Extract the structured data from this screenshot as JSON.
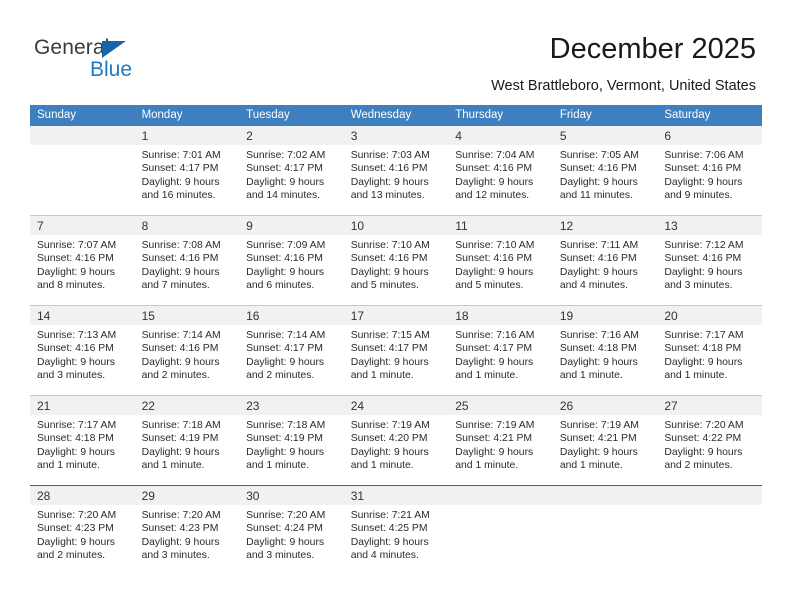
{
  "brand": {
    "name_part1": "General",
    "name_part2": "Blue",
    "triangle_icon": "triangle-icon",
    "primary_color": "#1e7ac0",
    "triangle_color": "#1565a8"
  },
  "header": {
    "title": "December 2025",
    "location": "West Brattleboro, Vermont, United States"
  },
  "calendar": {
    "header_bg": "#3d7fbf",
    "daynum_bg": "#f1f1f1",
    "grid_line": "#c8c8c8",
    "weekday_headers": [
      "Sunday",
      "Monday",
      "Tuesday",
      "Wednesday",
      "Thursday",
      "Friday",
      "Saturday"
    ],
    "weeks": [
      [
        {
          "day": "",
          "lines": []
        },
        {
          "day": "1",
          "lines": [
            "Sunrise: 7:01 AM",
            "Sunset: 4:17 PM",
            "Daylight: 9 hours",
            "and 16 minutes."
          ]
        },
        {
          "day": "2",
          "lines": [
            "Sunrise: 7:02 AM",
            "Sunset: 4:17 PM",
            "Daylight: 9 hours",
            "and 14 minutes."
          ]
        },
        {
          "day": "3",
          "lines": [
            "Sunrise: 7:03 AM",
            "Sunset: 4:16 PM",
            "Daylight: 9 hours",
            "and 13 minutes."
          ]
        },
        {
          "day": "4",
          "lines": [
            "Sunrise: 7:04 AM",
            "Sunset: 4:16 PM",
            "Daylight: 9 hours",
            "and 12 minutes."
          ]
        },
        {
          "day": "5",
          "lines": [
            "Sunrise: 7:05 AM",
            "Sunset: 4:16 PM",
            "Daylight: 9 hours",
            "and 11 minutes."
          ]
        },
        {
          "day": "6",
          "lines": [
            "Sunrise: 7:06 AM",
            "Sunset: 4:16 PM",
            "Daylight: 9 hours",
            "and 9 minutes."
          ]
        }
      ],
      [
        {
          "day": "7",
          "lines": [
            "Sunrise: 7:07 AM",
            "Sunset: 4:16 PM",
            "Daylight: 9 hours",
            "and 8 minutes."
          ]
        },
        {
          "day": "8",
          "lines": [
            "Sunrise: 7:08 AM",
            "Sunset: 4:16 PM",
            "Daylight: 9 hours",
            "and 7 minutes."
          ]
        },
        {
          "day": "9",
          "lines": [
            "Sunrise: 7:09 AM",
            "Sunset: 4:16 PM",
            "Daylight: 9 hours",
            "and 6 minutes."
          ]
        },
        {
          "day": "10",
          "lines": [
            "Sunrise: 7:10 AM",
            "Sunset: 4:16 PM",
            "Daylight: 9 hours",
            "and 5 minutes."
          ]
        },
        {
          "day": "11",
          "lines": [
            "Sunrise: 7:10 AM",
            "Sunset: 4:16 PM",
            "Daylight: 9 hours",
            "and 5 minutes."
          ]
        },
        {
          "day": "12",
          "lines": [
            "Sunrise: 7:11 AM",
            "Sunset: 4:16 PM",
            "Daylight: 9 hours",
            "and 4 minutes."
          ]
        },
        {
          "day": "13",
          "lines": [
            "Sunrise: 7:12 AM",
            "Sunset: 4:16 PM",
            "Daylight: 9 hours",
            "and 3 minutes."
          ]
        }
      ],
      [
        {
          "day": "14",
          "lines": [
            "Sunrise: 7:13 AM",
            "Sunset: 4:16 PM",
            "Daylight: 9 hours",
            "and 3 minutes."
          ]
        },
        {
          "day": "15",
          "lines": [
            "Sunrise: 7:14 AM",
            "Sunset: 4:16 PM",
            "Daylight: 9 hours",
            "and 2 minutes."
          ]
        },
        {
          "day": "16",
          "lines": [
            "Sunrise: 7:14 AM",
            "Sunset: 4:17 PM",
            "Daylight: 9 hours",
            "and 2 minutes."
          ]
        },
        {
          "day": "17",
          "lines": [
            "Sunrise: 7:15 AM",
            "Sunset: 4:17 PM",
            "Daylight: 9 hours",
            "and 1 minute."
          ]
        },
        {
          "day": "18",
          "lines": [
            "Sunrise: 7:16 AM",
            "Sunset: 4:17 PM",
            "Daylight: 9 hours",
            "and 1 minute."
          ]
        },
        {
          "day": "19",
          "lines": [
            "Sunrise: 7:16 AM",
            "Sunset: 4:18 PM",
            "Daylight: 9 hours",
            "and 1 minute."
          ]
        },
        {
          "day": "20",
          "lines": [
            "Sunrise: 7:17 AM",
            "Sunset: 4:18 PM",
            "Daylight: 9 hours",
            "and 1 minute."
          ]
        }
      ],
      [
        {
          "day": "21",
          "lines": [
            "Sunrise: 7:17 AM",
            "Sunset: 4:18 PM",
            "Daylight: 9 hours",
            "and 1 minute."
          ]
        },
        {
          "day": "22",
          "lines": [
            "Sunrise: 7:18 AM",
            "Sunset: 4:19 PM",
            "Daylight: 9 hours",
            "and 1 minute."
          ]
        },
        {
          "day": "23",
          "lines": [
            "Sunrise: 7:18 AM",
            "Sunset: 4:19 PM",
            "Daylight: 9 hours",
            "and 1 minute."
          ]
        },
        {
          "day": "24",
          "lines": [
            "Sunrise: 7:19 AM",
            "Sunset: 4:20 PM",
            "Daylight: 9 hours",
            "and 1 minute."
          ]
        },
        {
          "day": "25",
          "lines": [
            "Sunrise: 7:19 AM",
            "Sunset: 4:21 PM",
            "Daylight: 9 hours",
            "and 1 minute."
          ]
        },
        {
          "day": "26",
          "lines": [
            "Sunrise: 7:19 AM",
            "Sunset: 4:21 PM",
            "Daylight: 9 hours",
            "and 1 minute."
          ]
        },
        {
          "day": "27",
          "lines": [
            "Sunrise: 7:20 AM",
            "Sunset: 4:22 PM",
            "Daylight: 9 hours",
            "and 2 minutes."
          ]
        }
      ],
      [
        {
          "day": "28",
          "lines": [
            "Sunrise: 7:20 AM",
            "Sunset: 4:23 PM",
            "Daylight: 9 hours",
            "and 2 minutes."
          ]
        },
        {
          "day": "29",
          "lines": [
            "Sunrise: 7:20 AM",
            "Sunset: 4:23 PM",
            "Daylight: 9 hours",
            "and 3 minutes."
          ]
        },
        {
          "day": "30",
          "lines": [
            "Sunrise: 7:20 AM",
            "Sunset: 4:24 PM",
            "Daylight: 9 hours",
            "and 3 minutes."
          ]
        },
        {
          "day": "31",
          "lines": [
            "Sunrise: 7:21 AM",
            "Sunset: 4:25 PM",
            "Daylight: 9 hours",
            "and 4 minutes."
          ]
        },
        {
          "day": "",
          "lines": []
        },
        {
          "day": "",
          "lines": []
        },
        {
          "day": "",
          "lines": []
        }
      ]
    ]
  }
}
